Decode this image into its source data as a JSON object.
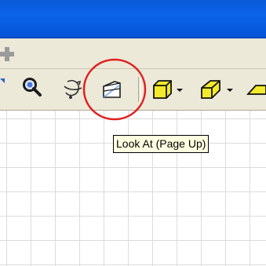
{
  "tooltip": {
    "text": "Look At (Page Up)"
  },
  "colors": {
    "titlebar": "#0b5ee0",
    "chrome": "#ece9d8",
    "tooltip_bg": "#ffffe1",
    "highlight": "#e02020",
    "cube_fill": "#f2ea2a"
  },
  "icons": [
    "plus-icon",
    "zoom-magnifier-icon",
    "orbit-icon",
    "look-at-icon",
    "cube-box-icon",
    "cube-wedge-icon",
    "dropdown-arrow-icon",
    "plane-icon"
  ]
}
